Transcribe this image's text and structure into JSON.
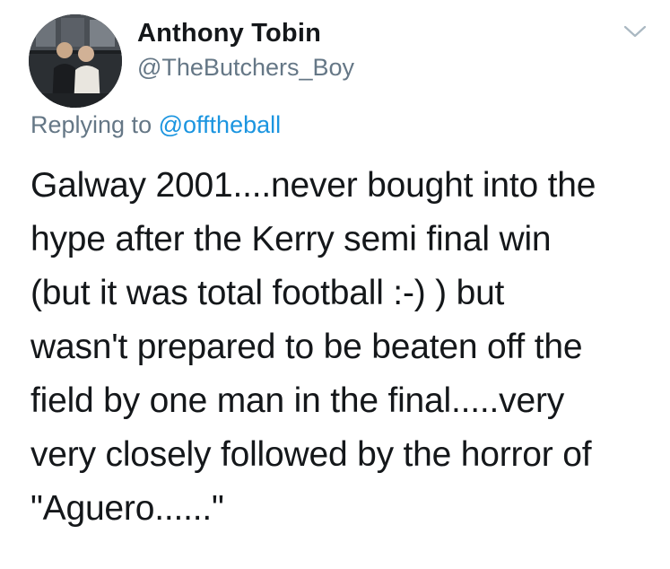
{
  "author": {
    "display_name": "Anthony Tobin",
    "handle": "@TheButchers_Boy",
    "avatar_icon": "profile-photo"
  },
  "menu": {
    "icon": "chevron-down-icon"
  },
  "reply": {
    "prefix": "Replying to",
    "mention": "@offtheball"
  },
  "tweet": {
    "lines": [
      "Galway 2001....never bought into the",
      "hype after the Kerry semi final win",
      "(but it was total football :-) ) but",
      "wasn't prepared to be beaten off the",
      "field by one man in the final.....very",
      "very closely followed by the horror of",
      "\"Aguero......\""
    ]
  },
  "colors": {
    "text_primary": "#14171a",
    "text_secondary": "#657786",
    "link": "#1b95e0",
    "chevron": "#aab8c2"
  }
}
